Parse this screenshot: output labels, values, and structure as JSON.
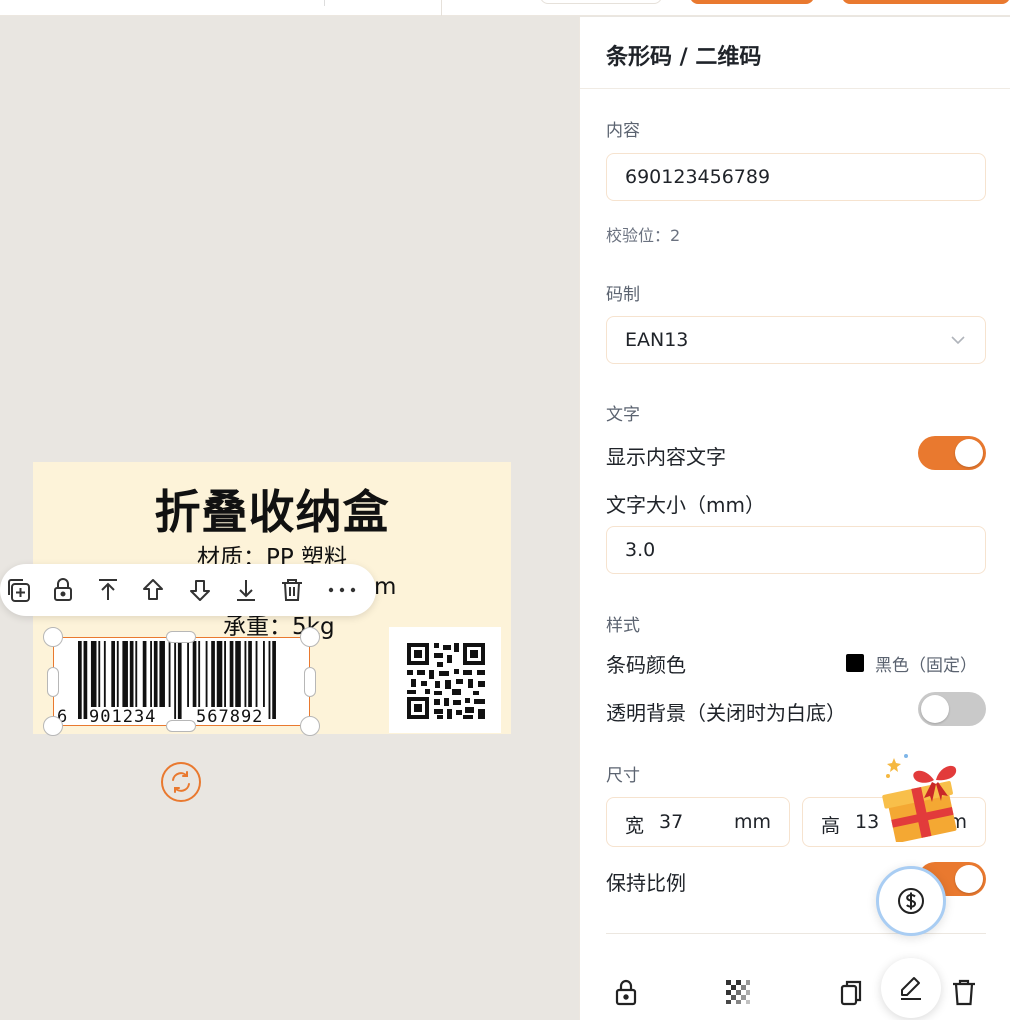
{
  "label": {
    "title": "折叠收纳盒",
    "material": "材质：PP 塑料",
    "size_suffix": "m",
    "weight": "承重：5kg"
  },
  "barcode": {
    "first_digit": "6",
    "left_digits": "901234",
    "right_digits": "567892"
  },
  "toolbar": {
    "icons": [
      "duplicate-icon",
      "lock-icon",
      "bring-to-front-icon",
      "move-up-icon",
      "move-down-icon",
      "send-to-back-icon",
      "delete-icon",
      "more-icon"
    ]
  },
  "panel": {
    "title": "条形码 / 二维码",
    "content_label": "内容",
    "content_value": "690123456789",
    "check_digit": "校验位：2",
    "symbology_label": "码制",
    "symbology_value": "EAN13",
    "text_section": "文字",
    "show_text_label": "显示内容文字",
    "show_text_on": true,
    "font_size_label": "文字大小（mm）",
    "font_size_value": "3.0",
    "style_section": "样式",
    "color_label": "条码颜色",
    "color_value": "黑色（固定）",
    "bar_color": "#000000",
    "transparent_label": "透明背景（关闭时为白底）",
    "transparent_on": false,
    "size_section": "尺寸",
    "width_key": "宽",
    "width_value": "37",
    "height_key": "高",
    "height_value": "13",
    "unit": "mm",
    "keep_ratio_label": "保持比例",
    "keep_ratio_on": true
  },
  "colors": {
    "accent": "#e9792f",
    "label_bg": "#fdf3d9",
    "canvas_bg": "#e9e6e1"
  }
}
